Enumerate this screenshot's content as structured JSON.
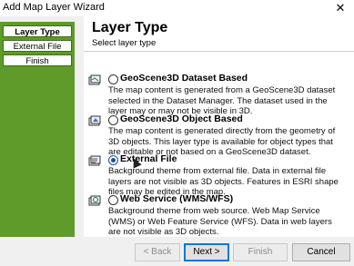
{
  "window": {
    "title": "Add Map Layer Wizard",
    "close_glyph": "✕"
  },
  "sidebar": {
    "steps": [
      {
        "label": "Layer Type"
      },
      {
        "label": "External File"
      },
      {
        "label": "Finish"
      }
    ]
  },
  "header": {
    "title": "Layer Type",
    "subtitle": "Select layer type"
  },
  "options": [
    {
      "label": "GeoScene3D Dataset Based",
      "description": "The map content is generated from a GeoScene3D dataset selected in the Dataset Manager. The dataset used in the layer may or may not be visible in 3D.",
      "icon": "dataset-layer-icon",
      "checked": false
    },
    {
      "label": "GeoScene3D Object Based",
      "description": "The map content is generated directly from the geometry of 3D objects. This layer type is available for object types that are editable or not based on a GeoScene3D dataset.",
      "icon": "object-layer-icon",
      "checked": false
    },
    {
      "label": "External File",
      "description": "Background theme from external file. Data in external file layers are not visible as 3D objects. Features in ESRI shape files may be edited in the map.",
      "icon": "external-file-layer-icon",
      "checked": true
    },
    {
      "label": "Web Service (WMS/WFS)",
      "description": "Background theme from web source. Web Map Service (WMS) or Web Feature Service (WFS). Data in web layers are not visible as 3D objects.",
      "icon": "web-service-layer-icon",
      "checked": false
    }
  ],
  "buttons": {
    "back": "< Back",
    "next": "Next >",
    "finish": "Finish",
    "cancel": "Cancel"
  },
  "colors": {
    "sidebar": "#5e9b2b",
    "radio_selected": "#1f4fa0"
  }
}
